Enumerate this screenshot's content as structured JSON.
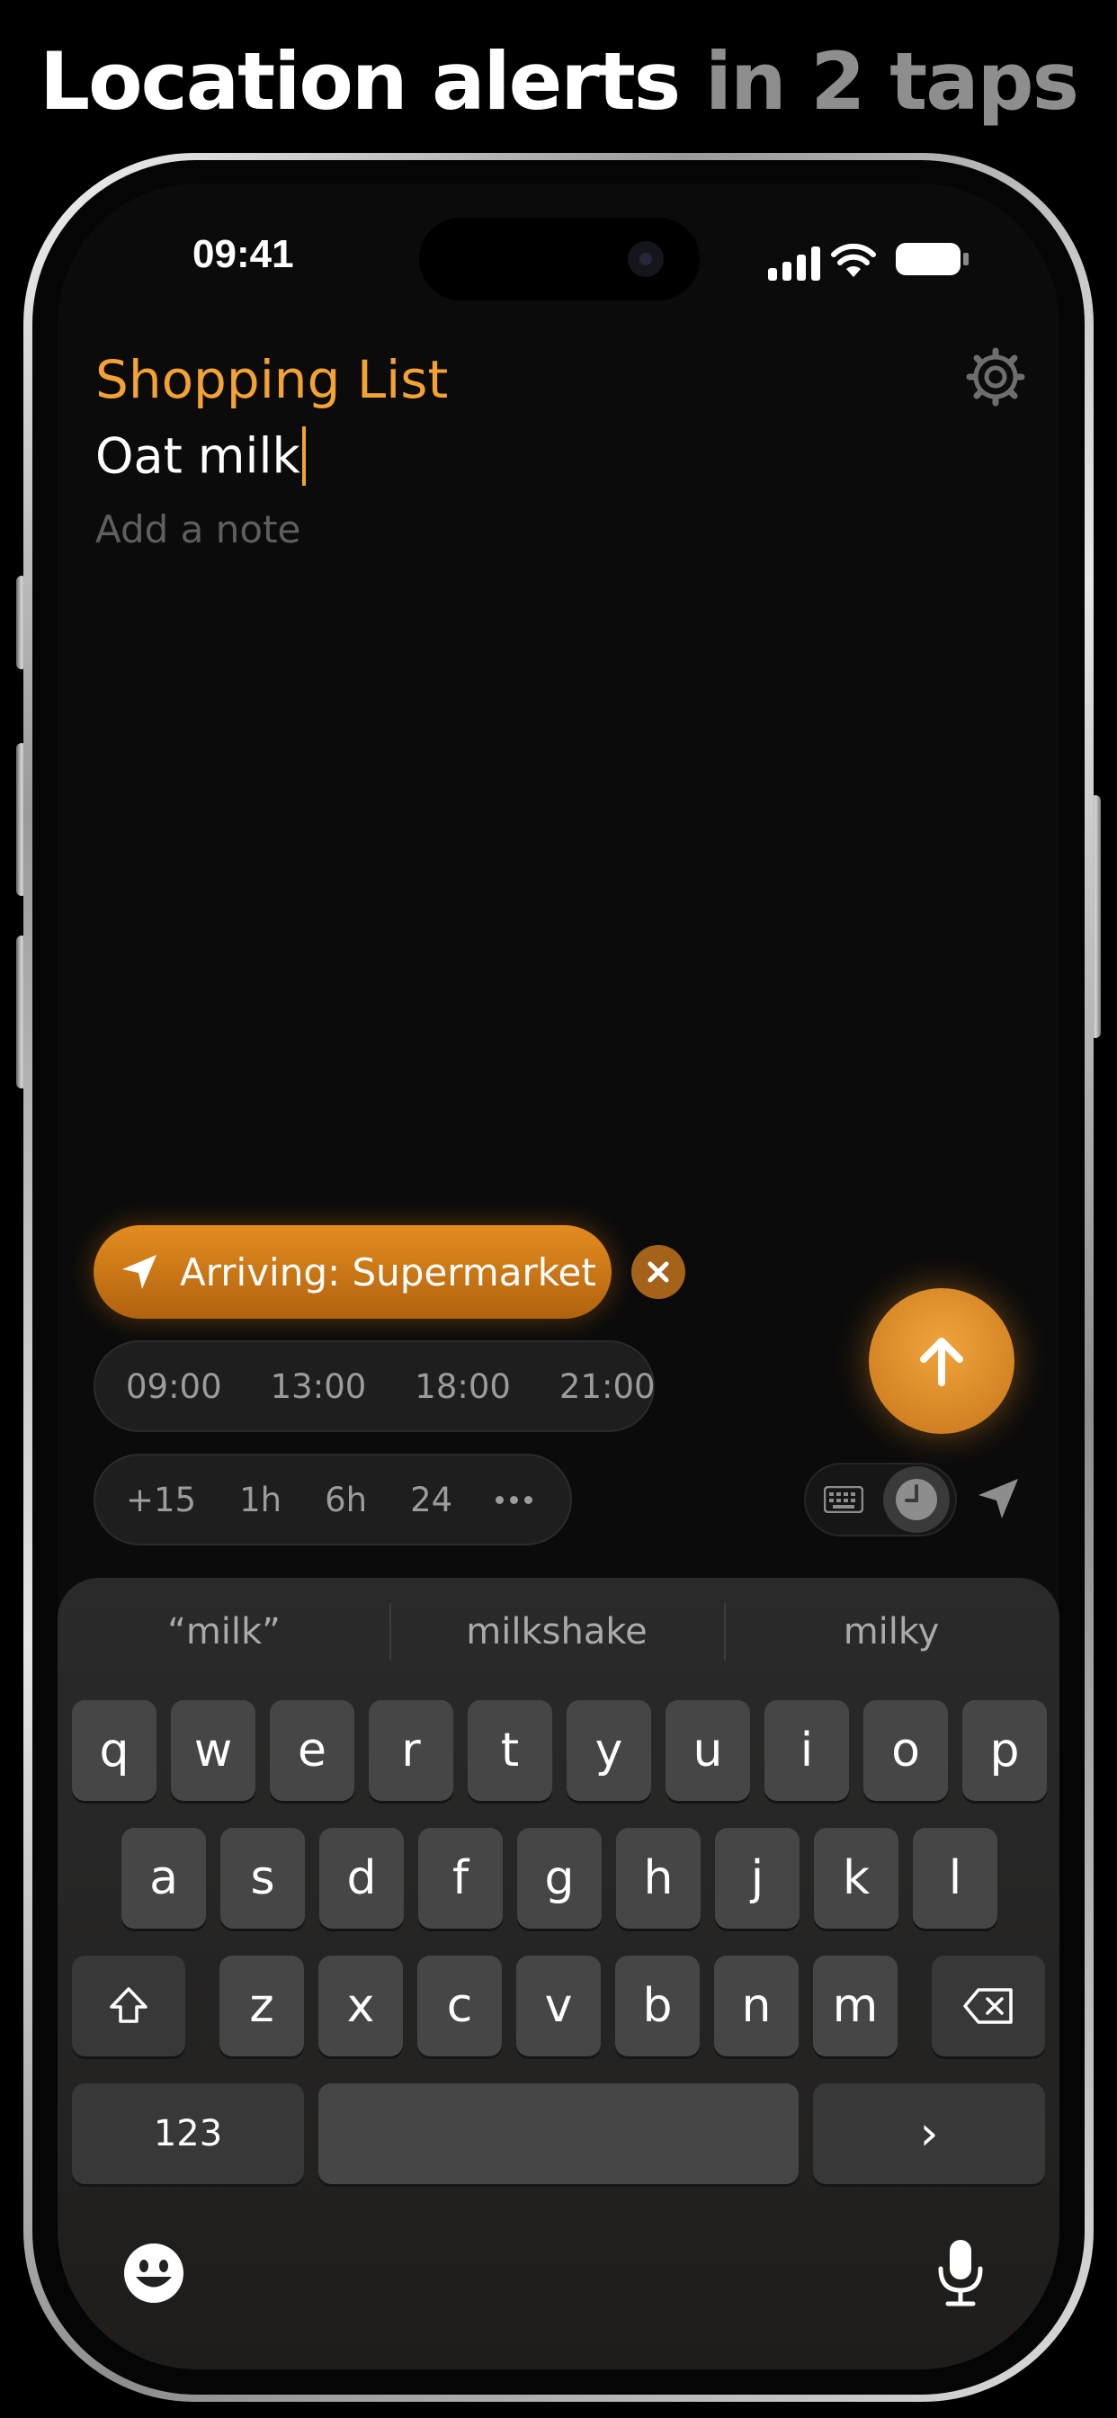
{
  "headline": {
    "part1": "Location alerts",
    "part2": "in 2 taps"
  },
  "status_bar": {
    "time": "09:41"
  },
  "list": {
    "title": "Shopping List",
    "item_text": "Oat milk",
    "note_placeholder": "Add a note"
  },
  "location_chip": {
    "label": "Arriving: Supermarket"
  },
  "time_presets": [
    "09:00",
    "13:00",
    "18:00",
    "21:00"
  ],
  "quick_presets": [
    "+15",
    "1h",
    "6h",
    "24"
  ],
  "keyboard": {
    "suggestions": [
      "“milk”",
      "milkshake",
      "milky"
    ],
    "row1": [
      "q",
      "w",
      "e",
      "r",
      "t",
      "y",
      "u",
      "i",
      "o",
      "p"
    ],
    "row2": [
      "a",
      "s",
      "d",
      "f",
      "g",
      "h",
      "j",
      "k",
      "l"
    ],
    "row3": [
      "z",
      "x",
      "c",
      "v",
      "b",
      "n",
      "m"
    ],
    "numbers_key": "123",
    "return_key": "›"
  },
  "colors": {
    "accent": "#f3a233",
    "background": "#0b0b0b",
    "key": "#464646"
  }
}
